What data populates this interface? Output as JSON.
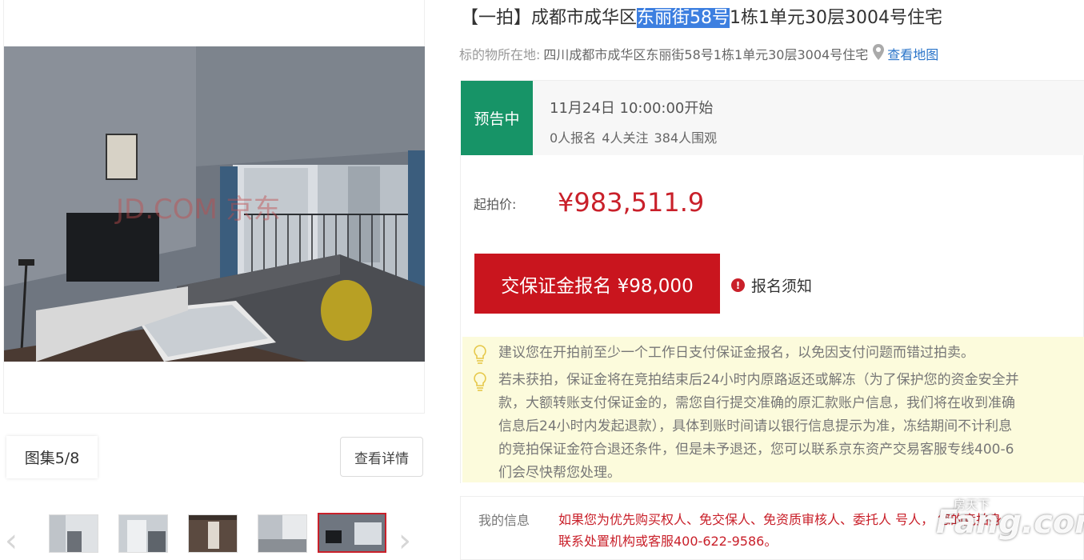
{
  "title": {
    "prefix": "【一拍】成都市成华区",
    "highlight": "东丽街58号",
    "suffix": "1栋1单元30层3004号住宅"
  },
  "location": {
    "label": "标的物所在地:",
    "address": "四川成都市成华区东丽街58号1栋1单元30层3004号住宅",
    "map_link": "查看地图",
    "icon": "map-pin-icon"
  },
  "status": {
    "badge": "预告中",
    "start_time": "11月24日 10:00:00开始",
    "stats": "0人报名  4人关注  384人围观"
  },
  "price": {
    "label": "起拍价:",
    "value": "¥983,511.9"
  },
  "deposit": {
    "button_label": "交保证金报名 ¥98,000",
    "notice_label": "报名须知"
  },
  "tips": [
    "建议您在开拍前至少一个工作日支付保证金报名，以免因支付问题而错过拍卖。",
    "若未获拍，保证金将在竞拍结束后24小时内原路返还或解冻（为了保护您的资金安全并",
    "款，大额转账支付保证金的，需您自行提交准确的原汇款账户信息，我们将在收到准确",
    "信息后24小时内发起退款），具体到账时间请以银行信息提示为准，冻结期间不计利息",
    "的竞拍保证金符合退还条件，但是未予退还，您可以联系京东资产交易客服专线400-6",
    "们会尽快帮您处理。"
  ],
  "my_info": {
    "label": "我的信息",
    "line1": "如果您为优先购买权人、免交保人、免资质审核人、委托人 号人，  您的竞拍身",
    "line2": "联系处置机构或客服400-622-9586。"
  },
  "gallery": {
    "counter": "图集5/8",
    "detail_button": "查看详情",
    "photo_watermark": "JD.COM 京东",
    "thumbnail_count": 5,
    "active_thumbnail": 5
  },
  "watermark": {
    "small": "房天下",
    "big": "Fang.com"
  },
  "colors": {
    "accent_red": "#c9151e",
    "status_green": "#179467",
    "link_blue": "#2a74c9",
    "tip_bg": "#fcfbdc",
    "highlight_blue": "#3d7fe0"
  }
}
